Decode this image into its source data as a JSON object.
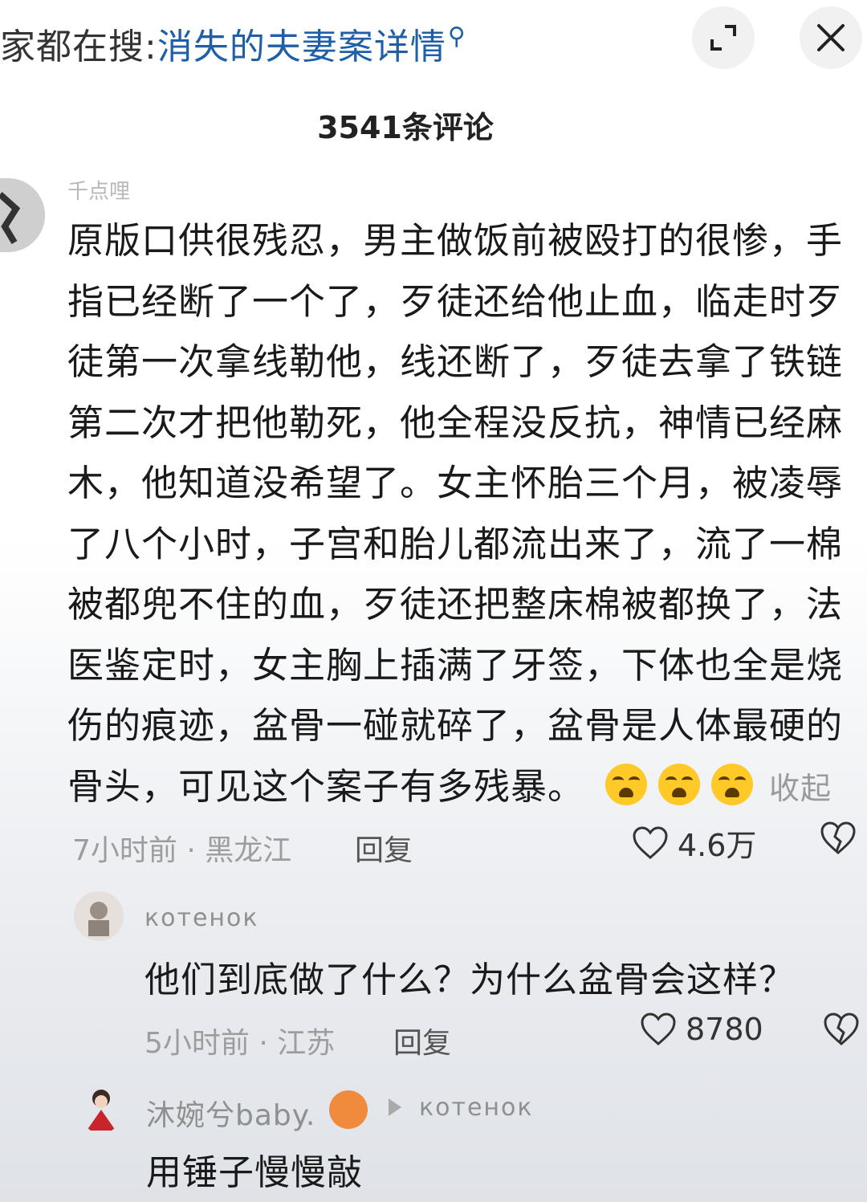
{
  "header": {
    "search_prefix": "家都在搜:",
    "search_query": "消失的夫妻案详情",
    "search_icon_glyph": "⚲",
    "comment_count": "3541条评论"
  },
  "comments": [
    {
      "username": "千点哩",
      "text": "原版口供很残忍，男主做饭前被殴打的很惨，手指已经断了一个了，歹徒还给他止血，临走时歹徒第一次拿线勒他，线还断了，歹徒去拿了铁链第二次才把他勒死，他全程没反抗，神情已经麻木，他知道没希望了。女主怀胎三个月，被凌辱了八个小时，子宫和胎儿都流出来了，流了一棉被都兜不住的血，歹徒还把整床棉被都换了，法医鉴定时，女主胸上插满了牙签，下体也全是烧伤的痕迹，盆骨一碰就碎了，盆骨是人体最硬的骨头，可见这个案子有多残暴。",
      "collapse_label": "收起",
      "meta": "7小时前 · 黑龙江",
      "reply_label": "回复",
      "likes": "4.6万"
    }
  ],
  "replies": [
    {
      "username": "котенок",
      "text": "他们到底做了什么？为什么盆骨会这样？",
      "meta": "5小时前 · 江苏",
      "reply_label": "回复",
      "likes": "8780"
    },
    {
      "username": "沐婉兮baby.",
      "reply_to": "котенок",
      "text": "用锤子慢慢敲"
    }
  ],
  "colors": {
    "link_blue": "#1f5fa8",
    "meta_gray": "#9d9d9d",
    "emoji_yellow": "#ffc928"
  }
}
